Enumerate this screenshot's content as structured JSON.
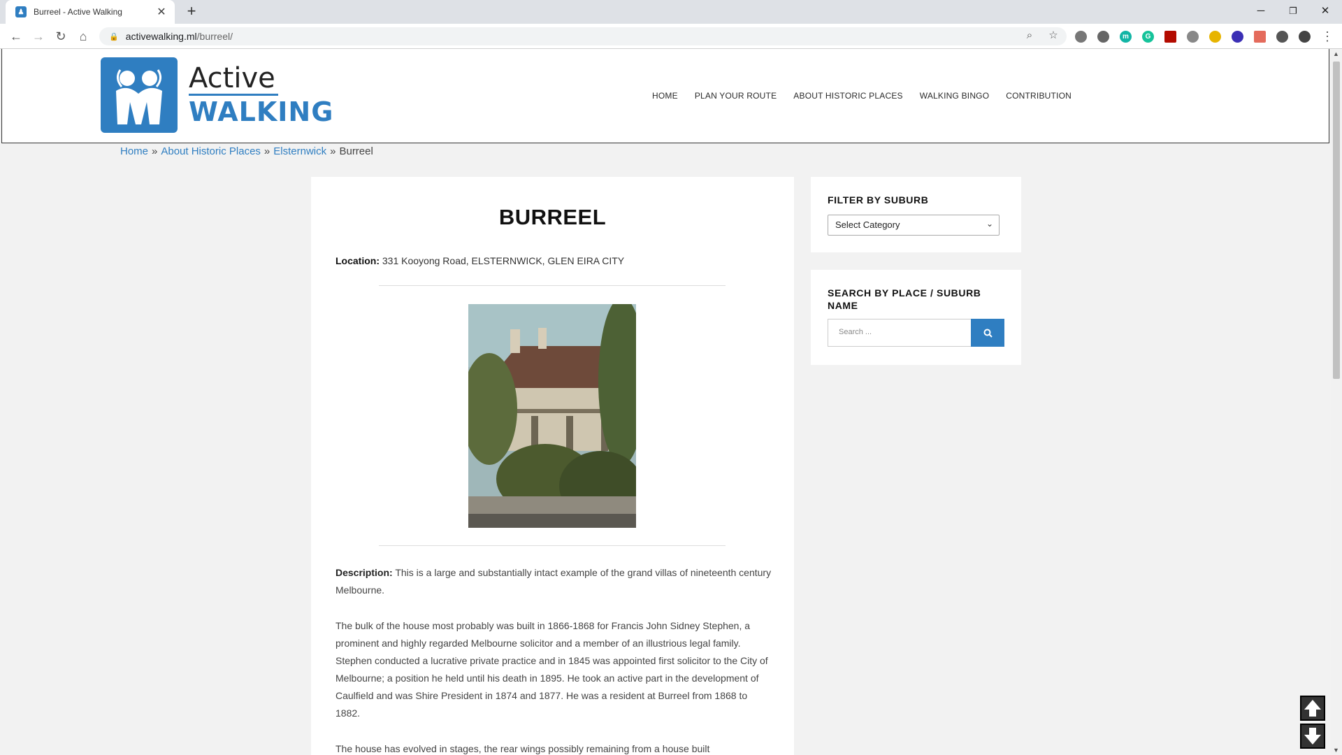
{
  "browser": {
    "tab_title": "Burreel - Active Walking",
    "tab_close": "✕",
    "new_tab": "+",
    "url_host": "activewalking.ml",
    "url_path": "/burreel/",
    "window_controls": {
      "minimize": "─",
      "restore": "❐",
      "close": "✕"
    }
  },
  "site": {
    "logo": {
      "line1": "Active",
      "line2": "WALKING"
    },
    "nav": [
      "HOME",
      "PLAN YOUR ROUTE",
      "ABOUT HISTORIC PLACES",
      "WALKING BINGO",
      "CONTRIBUTION"
    ]
  },
  "breadcrumb": {
    "items": [
      "Home",
      "About Historic Places",
      "Elsternwick"
    ],
    "separator": "»",
    "current": "Burreel"
  },
  "post": {
    "title": "BURREEL",
    "location_label": "Location:",
    "location_value": "331 Kooyong Road, ELSTERNWICK, GLEN EIRA CITY",
    "description_label": "Description:",
    "description_first": "This is a large and substantially intact example of the grand villas of nineteenth century Melbourne.",
    "paragraph2": "The bulk of the house most probably was built in 1866-1868 for Francis John Sidney Stephen, a prominent and highly regarded Melbourne solicitor and a member of an illustrious legal family. Stephen conducted a lucrative private practice and in 1845 was appointed first solicitor to the City of Melbourne; a position he held until his death in 1895. He took an active part in the development of Caulfield and was Shire President in 1874 and 1877. He was a resident at Burreel from 1868 to 1882.",
    "paragraph3": "The house has evolved in stages, the rear wings possibly remaining from a house built"
  },
  "sidebar": {
    "filter_title": "FILTER BY SUBURB",
    "filter_selected": "Select Category",
    "search_title": "SEARCH BY PLACE / SUBURB NAME",
    "search_placeholder": "Search ..."
  },
  "colors": {
    "brand": "#2f7ec1"
  },
  "icons": [
    "back-icon",
    "forward-icon",
    "reload-icon",
    "home-icon",
    "lock-icon",
    "zoom-icon",
    "star-icon",
    "search-icon",
    "arrow-up-icon",
    "arrow-down-icon"
  ]
}
